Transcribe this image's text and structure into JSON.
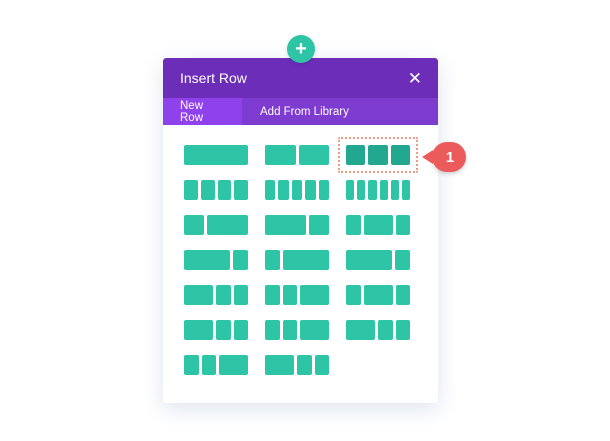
{
  "add_button": {
    "icon": "plus-icon",
    "glyph": "+"
  },
  "modal": {
    "title": "Insert Row",
    "close_glyph": "✕",
    "tabs": [
      {
        "label": "New Row",
        "active": true
      },
      {
        "label": "Add From Library",
        "active": false
      }
    ]
  },
  "layouts": [
    [
      1
    ],
    [
      1,
      1
    ],
    [
      1,
      1,
      1
    ],
    [
      1,
      1,
      1,
      1
    ],
    [
      1,
      1,
      1,
      1,
      1
    ],
    [
      1,
      1,
      1,
      1,
      1,
      1
    ],
    [
      1,
      2
    ],
    [
      2,
      1
    ],
    [
      1,
      2,
      1
    ],
    [
      3,
      1
    ],
    [
      1,
      3
    ],
    [
      3,
      1
    ],
    [
      2,
      1,
      1
    ],
    [
      1,
      1,
      2
    ],
    [
      1,
      2,
      1
    ],
    [
      2,
      1,
      1
    ],
    [
      1,
      1,
      2
    ],
    [
      2,
      1,
      1
    ],
    [
      1,
      1,
      2
    ],
    [
      2,
      1,
      1
    ]
  ],
  "selected_layout": 2,
  "annotation": {
    "label": "1"
  },
  "colors": {
    "header": "#6c2eb9",
    "tab_bar": "#7e3bd0",
    "tab_active": "#8f42ec",
    "column": "#2ec4a6",
    "column_selected": "#22a88e",
    "badge": "#ec5b5b",
    "selection_outline": "#ef9c86"
  }
}
